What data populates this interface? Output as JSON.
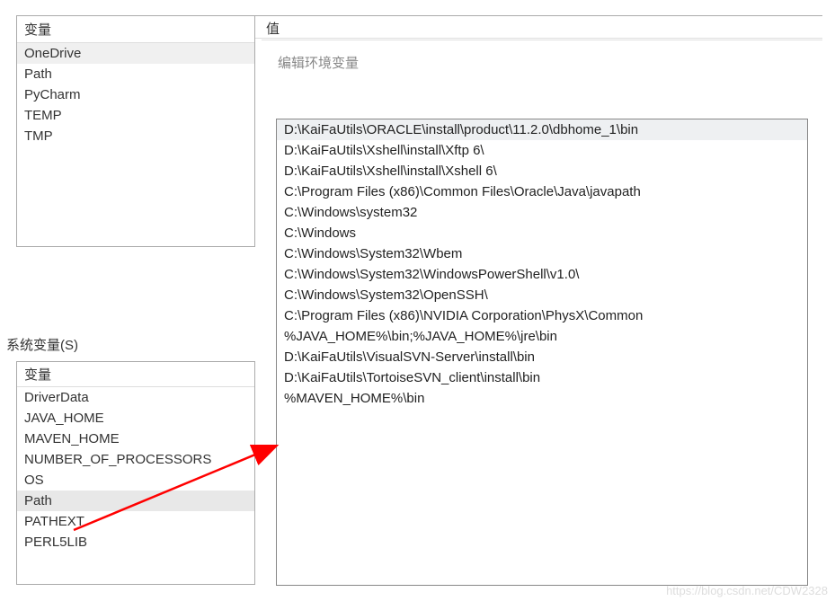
{
  "userVars": {
    "headerVar": "变量",
    "headerVal": "值",
    "items": [
      {
        "name": "OneDrive",
        "selected": true
      },
      {
        "name": "Path",
        "selected": false
      },
      {
        "name": "PyCharm",
        "selected": false
      },
      {
        "name": "TEMP",
        "selected": false
      },
      {
        "name": "TMP",
        "selected": false
      }
    ]
  },
  "editDialog": {
    "title": "编辑环境变量",
    "paths": [
      {
        "value": "D:\\KaiFaUtils\\ORACLE\\install\\product\\11.2.0\\dbhome_1\\bin",
        "selected": true
      },
      {
        "value": "D:\\KaiFaUtils\\Xshell\\install\\Xftp 6\\",
        "selected": false
      },
      {
        "value": "D:\\KaiFaUtils\\Xshell\\install\\Xshell 6\\",
        "selected": false
      },
      {
        "value": "C:\\Program Files (x86)\\Common Files\\Oracle\\Java\\javapath",
        "selected": false
      },
      {
        "value": "C:\\Windows\\system32",
        "selected": false
      },
      {
        "value": "C:\\Windows",
        "selected": false
      },
      {
        "value": "C:\\Windows\\System32\\Wbem",
        "selected": false
      },
      {
        "value": "C:\\Windows\\System32\\WindowsPowerShell\\v1.0\\",
        "selected": false
      },
      {
        "value": "C:\\Windows\\System32\\OpenSSH\\",
        "selected": false
      },
      {
        "value": "C:\\Program Files (x86)\\NVIDIA Corporation\\PhysX\\Common",
        "selected": false
      },
      {
        "value": "%JAVA_HOME%\\bin;%JAVA_HOME%\\jre\\bin",
        "selected": false
      },
      {
        "value": "D:\\KaiFaUtils\\VisualSVN-Server\\install\\bin",
        "selected": false
      },
      {
        "value": "D:\\KaiFaUtils\\TortoiseSVN_client\\install\\bin",
        "selected": false
      },
      {
        "value": "%MAVEN_HOME%\\bin",
        "selected": false
      }
    ]
  },
  "sysVars": {
    "label": "系统变量(S)",
    "header": "变量",
    "items": [
      {
        "name": "DriverData",
        "selected": false
      },
      {
        "name": "JAVA_HOME",
        "selected": false
      },
      {
        "name": "MAVEN_HOME",
        "selected": false
      },
      {
        "name": "NUMBER_OF_PROCESSORS",
        "selected": false
      },
      {
        "name": "OS",
        "selected": false
      },
      {
        "name": "Path",
        "selected": true
      },
      {
        "name": "PATHEXT",
        "selected": false
      },
      {
        "name": "PERL5LIB",
        "selected": false
      }
    ]
  },
  "watermark": "https://blog.csdn.net/CDW2328"
}
